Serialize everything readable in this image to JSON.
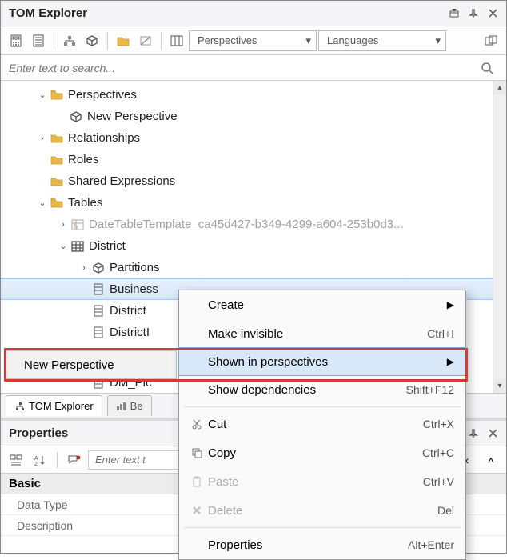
{
  "header": {
    "title": "TOM Explorer"
  },
  "toolbar": {
    "perspectives_combo": "Perspectives",
    "languages_combo": "Languages"
  },
  "search": {
    "placeholder": "Enter text to search..."
  },
  "tree": {
    "perspectives": {
      "label": "Perspectives",
      "children": [
        {
          "label": "New Perspective"
        }
      ]
    },
    "relationships": {
      "label": "Relationships"
    },
    "roles": {
      "label": "Roles"
    },
    "shared_expressions": {
      "label": "Shared Expressions"
    },
    "tables": {
      "label": "Tables",
      "children": {
        "date_template": {
          "label": "DateTableTemplate_ca45d427-b349-4299-a604-253b0d3..."
        },
        "district": {
          "label": "District",
          "children": {
            "partitions": {
              "label": "Partitions"
            },
            "cols": [
              {
                "label": "Business"
              },
              {
                "label": "District"
              },
              {
                "label": "DistrictI"
              },
              {
                "label": "DM_Pic"
              }
            ]
          }
        }
      }
    }
  },
  "context_menu": {
    "items": [
      {
        "label": "Create",
        "submenu": true
      },
      {
        "label": "Make invisible",
        "shortcut": "Ctrl+I"
      },
      {
        "label": "Shown in perspectives",
        "submenu": true,
        "highlight": true
      },
      {
        "label": "Show dependencies",
        "shortcut": "Shift+F12"
      },
      {
        "sep": true
      },
      {
        "label": "Cut",
        "shortcut": "Ctrl+X",
        "icon": "cut"
      },
      {
        "label": "Copy",
        "shortcut": "Ctrl+C",
        "icon": "copy"
      },
      {
        "label": "Paste",
        "shortcut": "Ctrl+V",
        "icon": "paste",
        "disabled": true
      },
      {
        "label": "Delete",
        "shortcut": "Del",
        "icon": "delete",
        "disabled": true
      },
      {
        "sep": true
      },
      {
        "label": "Properties",
        "shortcut": "Alt+Enter"
      }
    ]
  },
  "perspective_badge": {
    "label": "New Perspective"
  },
  "tabs": {
    "tom_explorer": "TOM Explorer",
    "best": "Be"
  },
  "properties": {
    "title": "Properties",
    "search_placeholder": "Enter text t",
    "group": "Basic",
    "rows": [
      {
        "name": "Data Type"
      },
      {
        "name": "Description"
      }
    ]
  }
}
